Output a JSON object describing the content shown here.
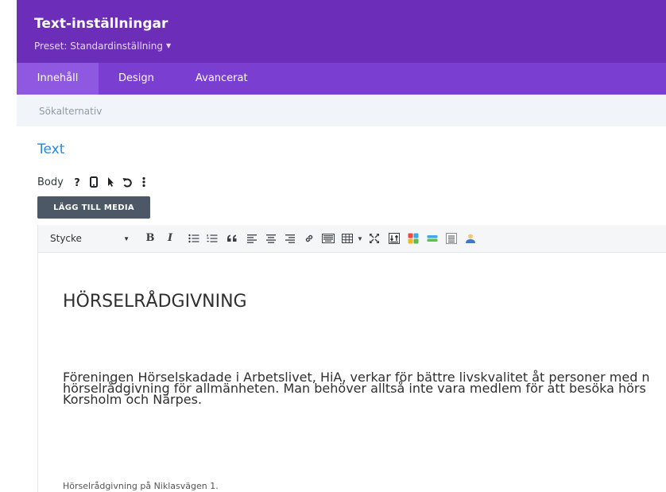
{
  "header": {
    "title": "Text-inställningar",
    "preset": "Preset: Standardinställning",
    "background": "#6c2eb9"
  },
  "tabs": [
    {
      "label": "Innehåll",
      "active": true
    },
    {
      "label": "Design",
      "active": false
    },
    {
      "label": "Avancerat",
      "active": false
    }
  ],
  "search": {
    "placeholder": "Sökalternativ",
    "value": ""
  },
  "section": {
    "title": "Text",
    "title_color": "#2b87da"
  },
  "field": {
    "label": "Body",
    "icons": [
      "help-icon",
      "mobile-icon",
      "cursor-icon",
      "undo-icon",
      "more-icon"
    ]
  },
  "media_button": {
    "label": "LÄGG TILL MEDIA"
  },
  "toolbar": {
    "format_select": {
      "value": "Stycke"
    },
    "bold": "B",
    "italic": "I",
    "buttons": [
      "bold-icon",
      "italic-icon",
      "bullet-list-icon",
      "numbered-list-icon",
      "blockquote-icon",
      "align-left-icon",
      "align-center-icon",
      "align-right-icon",
      "link-icon",
      "keyboard-icon",
      "table-icon",
      "fullscreen-icon",
      "insert-icon",
      "colors-icon",
      "hr-icon",
      "page-break-icon",
      "user-icon"
    ]
  },
  "content": {
    "heading": "HÖRSELRÅDGIVNING",
    "paragraph": [
      "Föreningen Hörselskadade i Arbetslivet, HiA, verkar för bättre livskvalitet åt personer med n",
      "hörselrådgivning för allmänheten. Man behöver alltså inte vara medlem för att besöka hörs",
      "Korsholm och Närpes."
    ],
    "note": "Hörselrådgivning på Niklasvägen 1."
  }
}
